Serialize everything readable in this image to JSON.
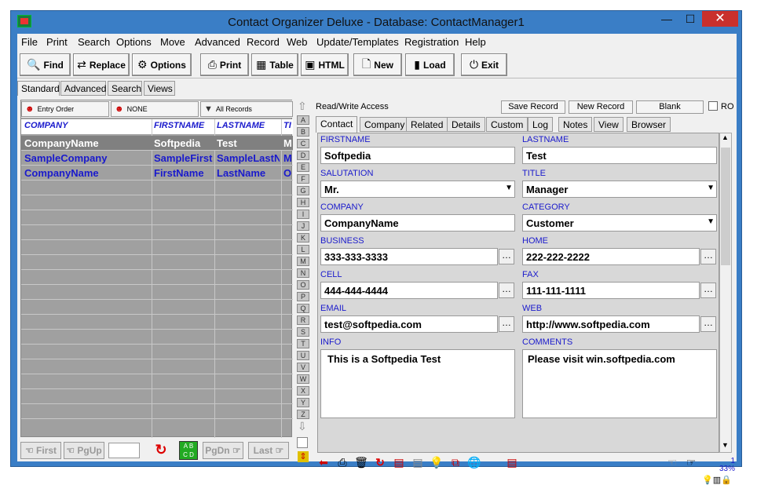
{
  "window": {
    "title": "Contact Organizer Deluxe - Database: ContactManager1",
    "minimize": "—",
    "maximize": "☐",
    "close": "✕"
  },
  "menu": [
    "File",
    "Print",
    "Search",
    "Options",
    "Move",
    "Advanced",
    "Record",
    "Web",
    "Update/Templates",
    "Registration",
    "Help"
  ],
  "toolbar": [
    {
      "label": "Find",
      "icon": "🔍"
    },
    {
      "label": "Replace",
      "icon": "⇄"
    },
    {
      "label": "Options",
      "icon": "⚙"
    },
    {
      "label": "Print",
      "icon": "⎙"
    },
    {
      "label": "Table",
      "icon": "▦"
    },
    {
      "label": "HTML",
      "icon": "▣"
    },
    {
      "label": "New",
      "icon": "🗋"
    },
    {
      "label": "Load",
      "icon": "▮"
    },
    {
      "label": "Exit",
      "icon": "⏻"
    }
  ],
  "mode_tabs": [
    "Standard",
    "Advanced",
    "Search",
    "Views"
  ],
  "sort_buttons": [
    "Entry Order",
    "NONE",
    "All Records"
  ],
  "grid": {
    "columns": [
      "COMPANY",
      "FIRSTNAME",
      "LASTNAME",
      "TI"
    ],
    "rows": [
      [
        "CompanyName",
        "Softpedia",
        "Test",
        "M"
      ],
      [
        "SampleCompany",
        "SampleFirst",
        "SampleLastN",
        "M"
      ],
      [
        "CompanyName",
        "FirstName",
        "LastName",
        "O"
      ]
    ]
  },
  "nav": {
    "first": "First",
    "pgup": "PgUp",
    "pgdn": "PgDn",
    "last": "Last",
    "record_input": ""
  },
  "alpha_letters": [
    "A",
    "B",
    "C",
    "D",
    "E",
    "F",
    "G",
    "H",
    "I",
    "J",
    "K",
    "L",
    "M",
    "N",
    "O",
    "P",
    "Q",
    "R",
    "S",
    "T",
    "U",
    "V",
    "W",
    "X",
    "Y",
    "Z"
  ],
  "record_bar": {
    "access": "Read/Write Access",
    "save": "Save Record",
    "new": "New Record",
    "blank": "Blank",
    "ro": "RO"
  },
  "detail_tabs": [
    "Contact",
    "Company",
    "Related",
    "Details",
    "Custom",
    "Log",
    "Notes",
    "View",
    "Browser"
  ],
  "form": {
    "firstname": {
      "label": "FIRSTNAME",
      "value": "Softpedia"
    },
    "lastname": {
      "label": "LASTNAME",
      "value": "Test"
    },
    "salutation": {
      "label": "SALUTATION",
      "value": "Mr."
    },
    "title": {
      "label": "TITLE",
      "value": "Manager"
    },
    "company": {
      "label": "COMPANY",
      "value": "CompanyName"
    },
    "category": {
      "label": "CATEGORY",
      "value": "Customer"
    },
    "business": {
      "label": "BUSINESS",
      "value": "333-333-3333"
    },
    "home": {
      "label": "HOME",
      "value": "222-222-2222"
    },
    "cell": {
      "label": "CELL",
      "value": "444-444-4444"
    },
    "fax": {
      "label": "FAX",
      "value": "111-111-1111"
    },
    "email": {
      "label": "EMAIL",
      "value": "test@softpedia.com"
    },
    "web": {
      "label": "WEB",
      "value": "http://www.softpedia.com"
    },
    "info": {
      "label": "INFO",
      "value": "This is a Softpedia Test"
    },
    "comments": {
      "label": "COMMENTS",
      "value": "Please visit win.softpedia.com"
    }
  },
  "status": {
    "record": "1",
    "zoom": "33%"
  }
}
